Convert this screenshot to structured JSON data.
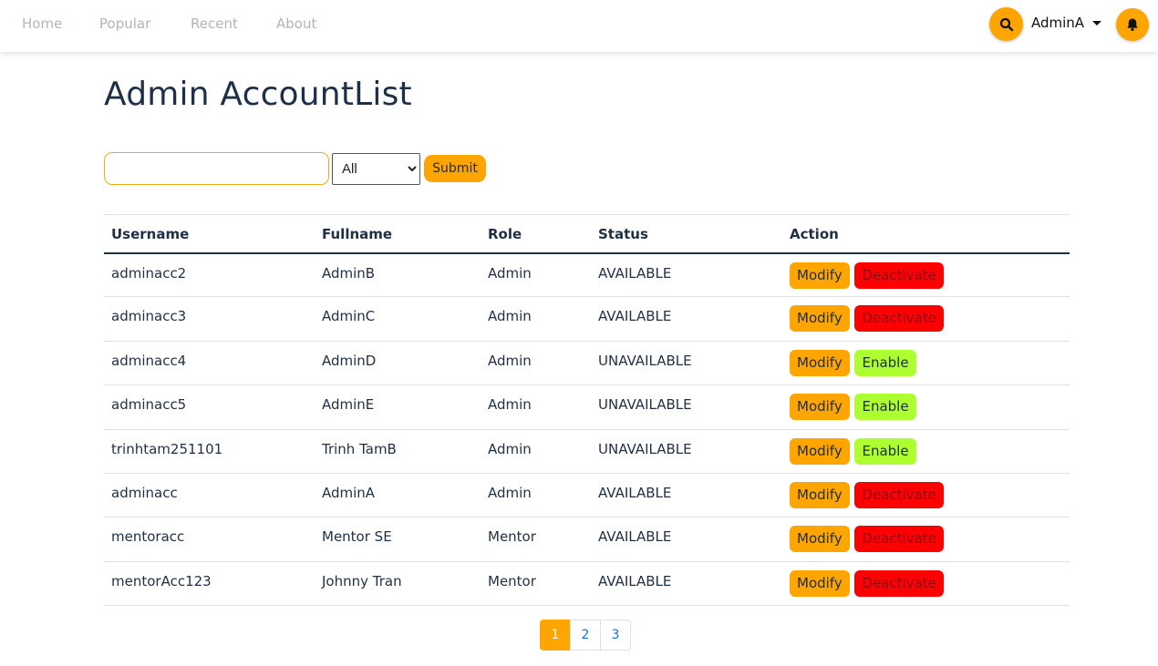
{
  "nav": {
    "links": [
      "Home",
      "Popular",
      "Recent",
      "About"
    ],
    "user": "AdminA"
  },
  "page": {
    "title": "Admin AccountList"
  },
  "filter": {
    "search_value": "",
    "selected_option": "All",
    "submit_label": "Submit"
  },
  "table": {
    "headers": [
      "Username",
      "Fullname",
      "Role",
      "Status",
      "Action"
    ],
    "rows": [
      {
        "username": "adminacc2",
        "fullname": "AdminB",
        "role": "Admin",
        "status": "AVAILABLE",
        "modify": "Modify",
        "toggle": "Deactivate"
      },
      {
        "username": "adminacc3",
        "fullname": "AdminC",
        "role": "Admin",
        "status": "AVAILABLE",
        "modify": "Modify",
        "toggle": "Deactivate"
      },
      {
        "username": "adminacc4",
        "fullname": "AdminD",
        "role": "Admin",
        "status": "UNAVAILABLE",
        "modify": "Modify",
        "toggle": "Enable"
      },
      {
        "username": "adminacc5",
        "fullname": "AdminE",
        "role": "Admin",
        "status": "UNAVAILABLE",
        "modify": "Modify",
        "toggle": "Enable"
      },
      {
        "username": "trinhtam251101",
        "fullname": "Trinh TamB",
        "role": "Admin",
        "status": "UNAVAILABLE",
        "modify": "Modify",
        "toggle": "Enable"
      },
      {
        "username": "adminacc",
        "fullname": "AdminA",
        "role": "Admin",
        "status": "AVAILABLE",
        "modify": "Modify",
        "toggle": "Deactivate"
      },
      {
        "username": "mentoracc",
        "fullname": "Mentor SE",
        "role": "Mentor",
        "status": "AVAILABLE",
        "modify": "Modify",
        "toggle": "Deactivate"
      },
      {
        "username": "mentorAcc123",
        "fullname": "Johnny Tran",
        "role": "Mentor",
        "status": "AVAILABLE",
        "modify": "Modify",
        "toggle": "Deactivate"
      }
    ]
  },
  "pagination": {
    "pages": [
      "1",
      "2",
      "3"
    ],
    "current": "1"
  },
  "colors": {
    "accent": "#ffa500",
    "deactivate": "#ff0000",
    "enable": "#adff2f",
    "heading": "#1e2f48"
  },
  "icons": {
    "search": "search-icon",
    "bell": "bell-icon",
    "caret": "caret-down-icon"
  }
}
